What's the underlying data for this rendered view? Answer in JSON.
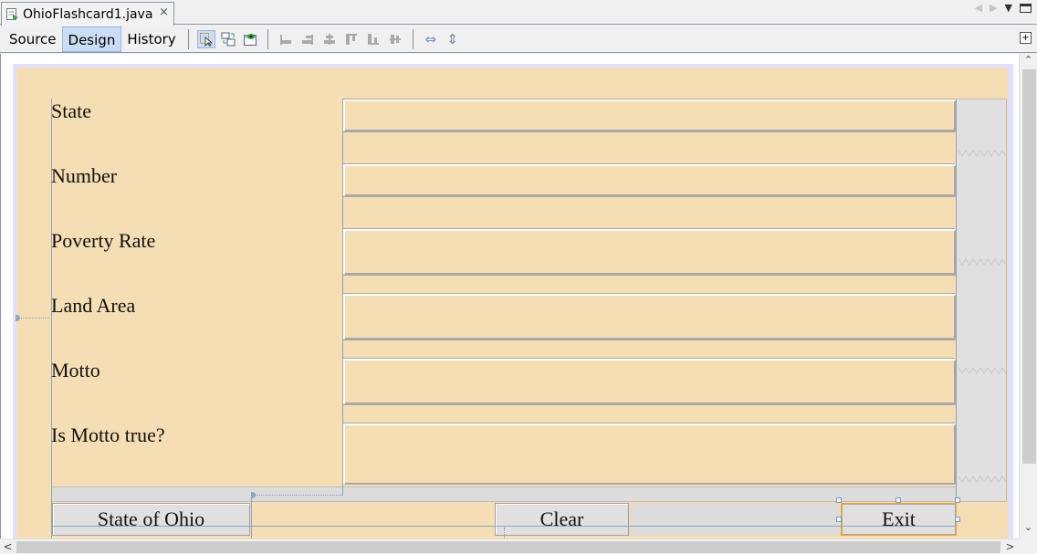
{
  "editor": {
    "tab_title": "OhioFlashcard1.java",
    "tab_close": "×",
    "file_icon": "java-form-file-icon",
    "nav_left_icon": "◀",
    "nav_right_icon": "▶",
    "dropdown_icon": "▼"
  },
  "toolbar": {
    "modes": [
      {
        "label": "Source",
        "active": false
      },
      {
        "label": "Design",
        "active": true
      },
      {
        "label": "History",
        "active": false
      }
    ],
    "tools": [
      {
        "name": "selection-mode-icon",
        "glyph": "⬚",
        "selected": true
      },
      {
        "name": "connection-mode-icon",
        "glyph": "⇄",
        "selected": false
      },
      {
        "name": "preview-design-icon",
        "glyph": "◉",
        "selected": false
      }
    ],
    "align_tools": [
      {
        "name": "align-left-icon",
        "glyph": "⊏"
      },
      {
        "name": "align-right-icon",
        "glyph": "⊐"
      },
      {
        "name": "center-horizontally-icon",
        "glyph": "╪"
      },
      {
        "name": "align-top-icon",
        "glyph": "⊓"
      },
      {
        "name": "align-bottom-icon",
        "glyph": "⊔"
      },
      {
        "name": "center-vertically-icon",
        "glyph": "╫"
      }
    ],
    "resize_tools": [
      {
        "name": "change-horizontal-resizability-icon",
        "glyph": "⇔"
      },
      {
        "name": "change-vertical-resizability-icon",
        "glyph": "⇕"
      }
    ],
    "expand_icon": "+"
  },
  "form": {
    "labels": [
      "State",
      "Number",
      "Poverty Rate",
      "Land Area",
      "Motto",
      "Is Motto true?"
    ],
    "fields": [
      "",
      "",
      "",
      "",
      "",
      ""
    ],
    "buttons": {
      "state": "State of Ohio",
      "clear": "Clear",
      "exit": "Exit"
    },
    "colors": {
      "background": "#f5deb3",
      "selection": "#f5a623",
      "guide": "#8ea6c0"
    }
  },
  "scrollbars": {
    "up": "⌃",
    "down": "⌄",
    "left": "<",
    "right": ">"
  }
}
